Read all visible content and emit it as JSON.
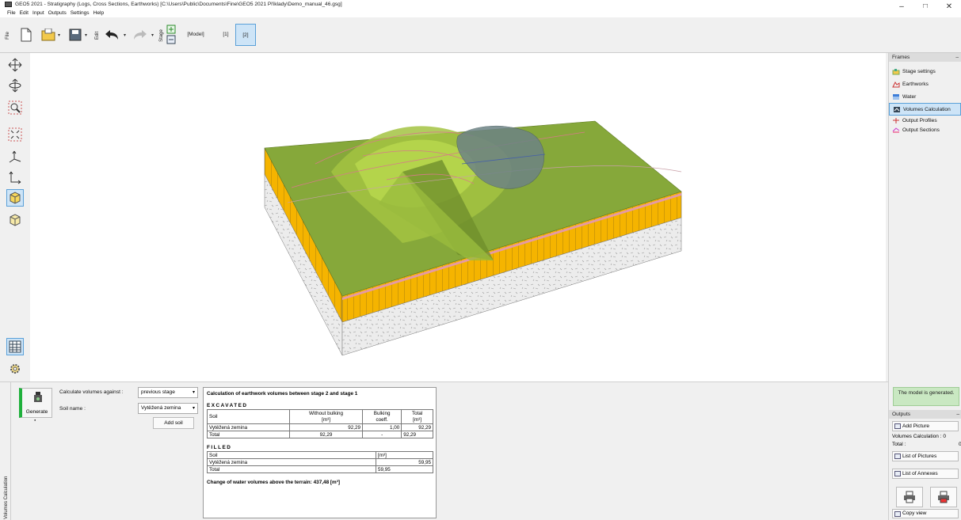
{
  "window": {
    "title": "GEO5 2021 - Stratigraphy (Logs, Cross Sections, Earthworks) [C:\\Users\\Public\\Documents\\Fine\\GEO5 2021 Příklady\\Demo_manual_46.gsg]",
    "minimize": "–",
    "maximize": "□",
    "close": "✕"
  },
  "menu": [
    "File",
    "Edit",
    "Input",
    "Outputs",
    "Settings",
    "Help"
  ],
  "toolbar": {
    "file_tab": "File",
    "edit_tab": "Edit",
    "stage_tab": "Stage",
    "stages": [
      {
        "label": "[Model]",
        "active": false
      },
      {
        "label": "[1]",
        "active": false
      },
      {
        "label": "[2]",
        "active": true
      }
    ]
  },
  "frames": {
    "header": "Frames",
    "items": [
      {
        "label": "Stage settings",
        "icon": "stage-settings-icon",
        "active": false
      },
      {
        "label": "Earthworks",
        "icon": "earthworks-icon",
        "active": false
      },
      {
        "label": "Water",
        "icon": "water-icon",
        "active": false
      },
      {
        "label": "Volumes Calculation",
        "icon": "volumes-calculation-icon",
        "active": true
      },
      {
        "label": "Output Profiles",
        "icon": "output-profiles-icon",
        "active": false
      },
      {
        "label": "Output Sections",
        "icon": "output-sections-icon",
        "active": false
      }
    ]
  },
  "bottom": {
    "side_tab": "Volumes Calculation",
    "generate_label": "Generate",
    "calc_against_label": "Calculate volumes against :",
    "calc_against_value": "previous stage",
    "soil_name_label": "Soil name :",
    "soil_name_value": "Vytěžená zemina",
    "add_soil": "Add soil"
  },
  "results": {
    "title": "Calculation of earthwork volumes between stage 2 and stage 1",
    "excavated": {
      "heading": "EXCAVATED",
      "col_soil": "Soil",
      "col_without_bulking_1": "Without bulking",
      "col_without_bulking_2": "[m³]",
      "col_bulking_1": "Bulking",
      "col_bulking_2": "coeff.",
      "col_total_1": "Total",
      "col_total_2": "[m³]",
      "rows": [
        {
          "soil": "Vytěžená zemina",
          "without": "92,29",
          "coeff": "1,00",
          "total": "92,29"
        },
        {
          "soil": "Total",
          "without": "92,29",
          "coeff": "-",
          "total": "92,29"
        }
      ]
    },
    "filled": {
      "heading": "FILLED",
      "col_soil": "Soil",
      "col_unit": "[m³]",
      "rows": [
        {
          "soil": "Vytěžená zemina",
          "value": "59,95"
        },
        {
          "soil": "Total",
          "value": "59,95"
        }
      ]
    },
    "water_change": "Change of water volumes above the terrain: 437,48 [m³]"
  },
  "right_bottom": {
    "status": "The model is generated.",
    "outputs_header": "Outputs",
    "add_picture": "Add Picture",
    "volumes_calc_line": "Volumes Calculation :",
    "volumes_calc_count": "0",
    "total_line": "Total :",
    "total_count": "0",
    "list_of_pictures": "List of Pictures",
    "list_of_annexes": "List of Annexes",
    "copy_view": "Copy view"
  },
  "colors": {
    "terrain_top": "#86a83a",
    "terrain_light": "#b9d94e",
    "soil_layer": "#f5b400",
    "rock": "#e6e6e6",
    "water": "#6d8385",
    "active_tab": "#cde4f7",
    "status_ok": "#c9e8c2"
  }
}
